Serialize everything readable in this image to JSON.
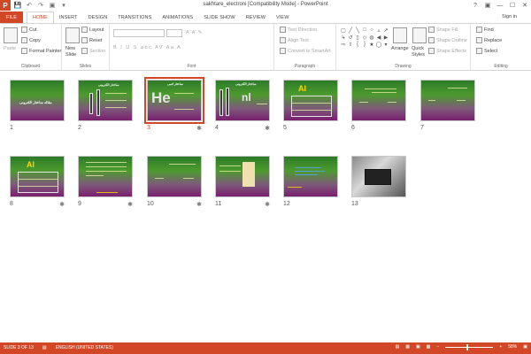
{
  "window": {
    "title": "sakhtare_electroni [Compatibility Mode] - PowerPoint",
    "logo": "P"
  },
  "qat": [
    "save-icon",
    "undo-icon",
    "redo-icon",
    "start-show-icon",
    "customize-icon"
  ],
  "window_controls": [
    "?",
    "▣",
    "—",
    "☐",
    "✕"
  ],
  "tabs": [
    {
      "label": "FILE",
      "file": true
    },
    {
      "label": "HOME",
      "active": true
    },
    {
      "label": "INSERT"
    },
    {
      "label": "DESIGN"
    },
    {
      "label": "TRANSITIONS"
    },
    {
      "label": "ANIMATIONS"
    },
    {
      "label": "SLIDE SHOW"
    },
    {
      "label": "REVIEW"
    },
    {
      "label": "VIEW"
    }
  ],
  "signin": "Sign in",
  "ribbon": {
    "clipboard": {
      "paste": "Paste",
      "cut": "Cut",
      "copy": "Copy",
      "format_painter": "Format Painter",
      "label": "Clipboard"
    },
    "slides": {
      "new_slide_1": "New",
      "new_slide_2": "Slide",
      "layout": "Layout",
      "reset": "Reset",
      "section": "Section",
      "label": "Slides"
    },
    "font": {
      "label": "Font",
      "buttons": "B I U S abc AV Aa A"
    },
    "paragraph": {
      "text_direction": "Text Direction",
      "align_text": "Align Text",
      "convert": "Convert to SmartArt",
      "label": "Paragraph"
    },
    "drawing": {
      "arrange": "Arrange",
      "quick_styles_1": "Quick",
      "quick_styles_2": "Styles",
      "shape_fill": "Shape Fill",
      "shape_outline": "Shape Outline",
      "shape_effects": "Shape Effects",
      "label": "Drawing"
    },
    "editing": {
      "find": "Find",
      "replace": "Replace",
      "select": "Select",
      "label": "Editing"
    }
  },
  "slides": [
    {
      "num": "1",
      "star": false,
      "title": "مقاله ساختار الکترونی"
    },
    {
      "num": "2",
      "star": false,
      "title": "ساختار الکترونی"
    },
    {
      "num": "3",
      "star": true,
      "selected": true,
      "title": "ساختار اتمی",
      "big": "He"
    },
    {
      "num": "4",
      "star": true,
      "title": "ساختار الکترونی",
      "big": "nl"
    },
    {
      "num": "5",
      "star": false,
      "big": "Al"
    },
    {
      "num": "6",
      "star": false
    },
    {
      "num": "7",
      "star": false
    },
    {
      "num": "8",
      "star": true,
      "big": "Al"
    },
    {
      "num": "9",
      "star": true
    },
    {
      "num": "10",
      "star": true
    },
    {
      "num": "11",
      "star": true
    },
    {
      "num": "12",
      "star": false
    },
    {
      "num": "13",
      "star": false,
      "photo": true
    }
  ],
  "status": {
    "slide": "SLIDE 3 OF 13",
    "language": "ENGLISH (UNITED STATES)",
    "zoom": "58%"
  },
  "colors": {
    "accent": "#d24726",
    "slide_top": "#2d7a2a",
    "slide_bottom": "#7a1f6e"
  }
}
